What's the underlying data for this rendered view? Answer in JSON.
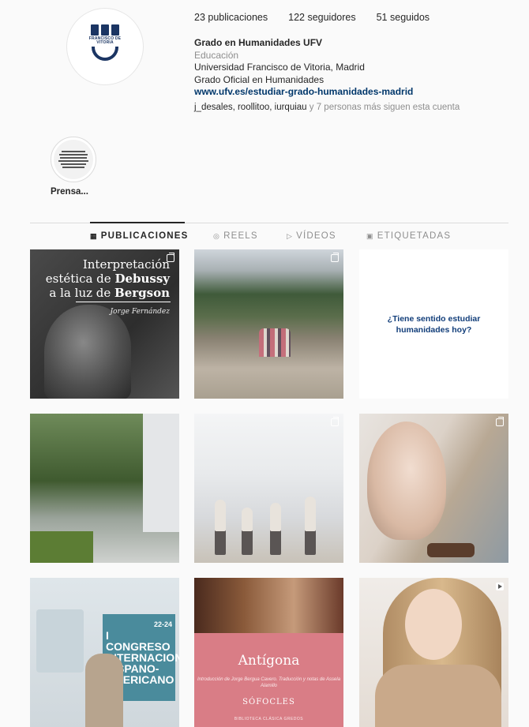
{
  "profile": {
    "logo_text": "FRANCISCO DE VITORIA",
    "stats": {
      "posts": "23 publicaciones",
      "followers": "122 seguidores",
      "following": "51 seguidos"
    },
    "name": "Grado en Humanidades UFV",
    "category": "Educación",
    "bio_line1": "Universidad Francisco de Vitoria, Madrid",
    "bio_line2": "Grado Oficial en Humanidades",
    "link": "www.ufv.es/estudiar-grado-humanidades-madrid",
    "followed_by_names": "j_desales, roollitoo, iurquiau",
    "followed_by_rest": " y 7 personas más siguen esta cuenta"
  },
  "highlights": [
    {
      "label": "Prensa..."
    }
  ],
  "tabs": [
    {
      "label": "PUBLICACIONES",
      "icon": "grid-icon",
      "active": true
    },
    {
      "label": "REELS",
      "icon": "reels-icon",
      "active": false
    },
    {
      "label": "VÍDEOS",
      "icon": "video-icon",
      "active": false
    },
    {
      "label": "ETIQUETADAS",
      "icon": "tag-icon",
      "active": false
    }
  ],
  "posts": [
    {
      "type": "carousel",
      "title_l1": "Interpretación",
      "title_l2": "estética de ",
      "title_l2b": "Debussy",
      "title_l3": "a la luz de ",
      "title_l3b": "Bergson",
      "author": "Jorge Fernández"
    },
    {
      "type": "carousel"
    },
    {
      "type": "image",
      "text": "¿Tiene sentido estudiar humanidades hoy?"
    },
    {
      "type": "image"
    },
    {
      "type": "carousel"
    },
    {
      "type": "carousel"
    },
    {
      "type": "image",
      "poster_text": "I CONGRESO INTERNACIONAL HISPANO-AMERICANO",
      "poster_dates": "22-24"
    },
    {
      "type": "image",
      "book_title": "Antígona",
      "book_subtitle": "Introducción de Jorge Bergua Cavero. Traducción y notas de Assela Alamillo",
      "book_author": "SÓFOCLES",
      "book_collection": "BIBLIOTECA CLÁSICA GREDOS"
    },
    {
      "type": "reel"
    }
  ]
}
